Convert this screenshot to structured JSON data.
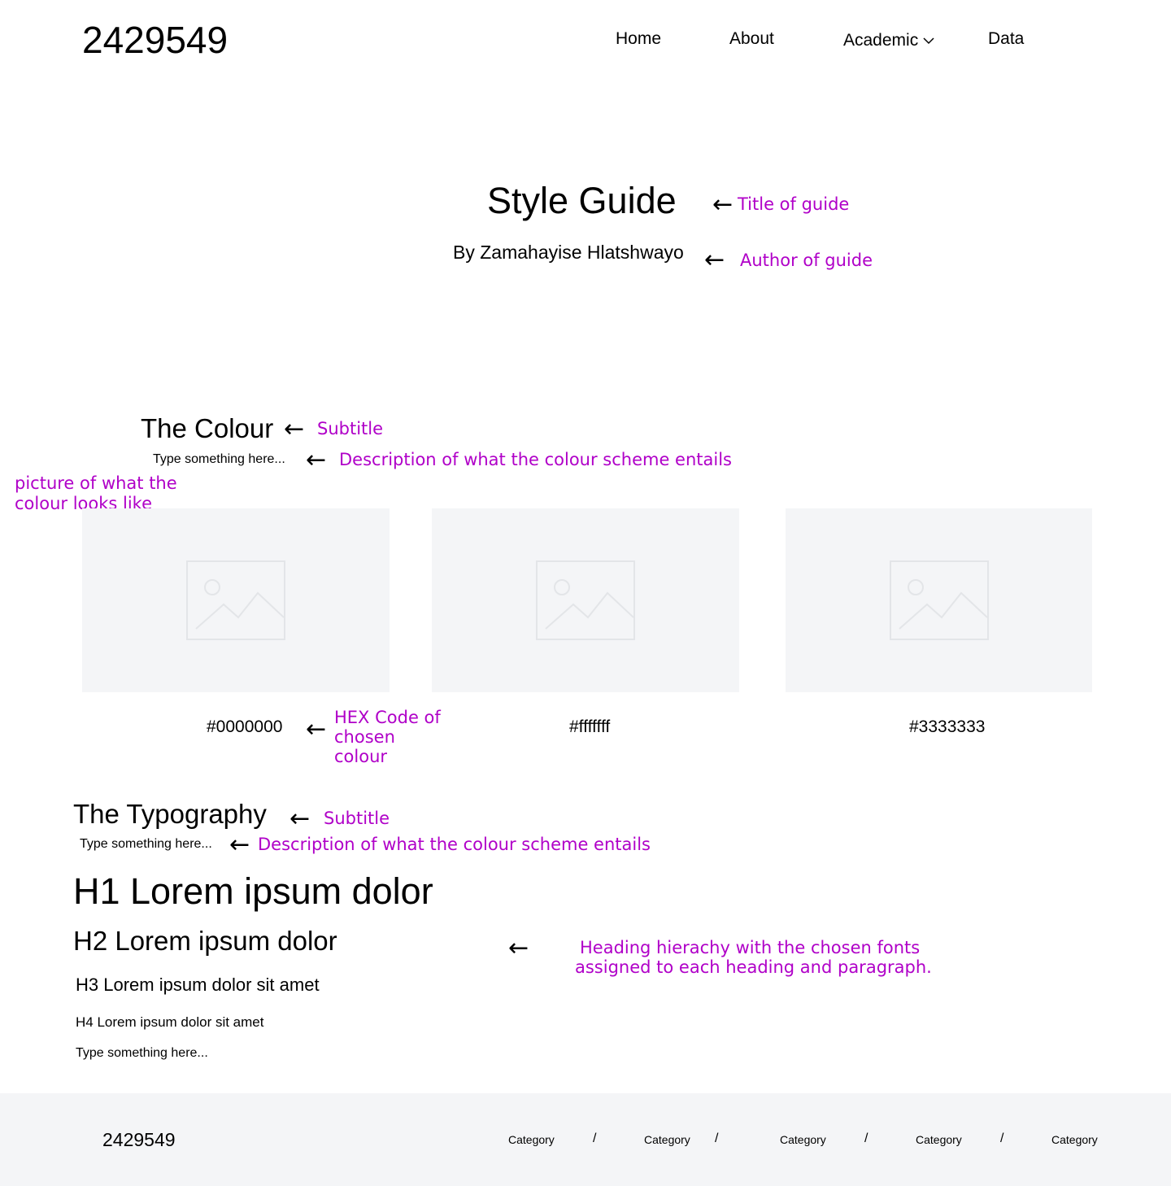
{
  "header": {
    "brand": "2429549",
    "nav": {
      "home": "Home",
      "about": "About",
      "academic": "Academic",
      "data": "Data"
    }
  },
  "hero": {
    "title": "Style Guide",
    "author": "By Zamahayise Hlatshwayo"
  },
  "colour_section": {
    "subtitle": "The Colour",
    "description": "Type something here...",
    "swatches": [
      {
        "hex": "#0000000"
      },
      {
        "hex": "#fffffff"
      },
      {
        "hex": "#3333333"
      }
    ]
  },
  "typography_section": {
    "subtitle": "The Typography",
    "description": "Type something here...",
    "h1": "H1 Lorem ipsum dolor",
    "h2": "H2 Lorem ipsum dolor",
    "h3": "H3 Lorem ipsum dolor sit amet",
    "h4": "H4 Lorem ipsum dolor sit amet",
    "paragraph": "Type something here..."
  },
  "annotations": {
    "title": "Title of guide",
    "author": "Author of guide",
    "colour_subtitle": "Subtitle",
    "colour_description": "Description of what the colour scheme entails",
    "picture_line1": "picture of what the",
    "picture_line2": "colour looks like",
    "hex_line1": "HEX Code of",
    "hex_line2": "chosen",
    "hex_line3": "colour",
    "typography_subtitle": "Subtitle",
    "typography_description": "Description of what the colour scheme entails",
    "hierarchy_line1": "Heading hierachy with the chosen fonts",
    "hierarchy_line2": "assigned to each heading and paragraph."
  },
  "footer": {
    "brand": "2429549",
    "categories": [
      "Category",
      "Category",
      "Category",
      "Category",
      "Category"
    ],
    "separator": "/"
  },
  "arrows": {
    "left": "←",
    "down_right": "↘"
  },
  "colors": {
    "annotation": "#b000c8",
    "placeholder_bg": "#f4f5f7",
    "placeholder_icon": "#e3e5e8"
  }
}
